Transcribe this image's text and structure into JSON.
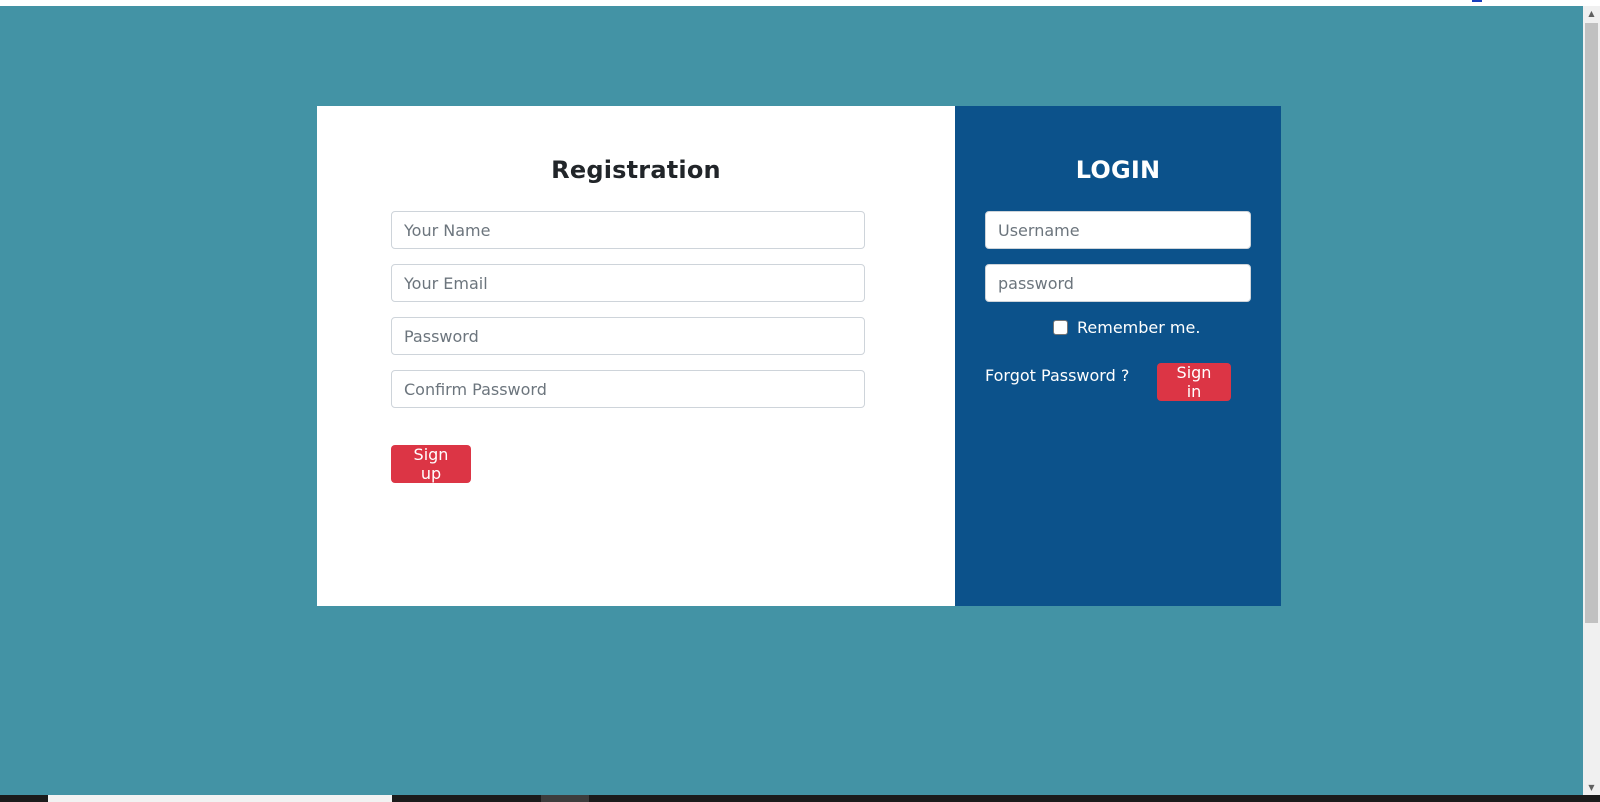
{
  "registration": {
    "title": "Registration",
    "name_placeholder": "Your Name",
    "email_placeholder": "Your Email",
    "password_placeholder": "Password",
    "confirm_placeholder": "Confirm Password",
    "signup_label": "Sign up"
  },
  "login": {
    "title": "LOGIN",
    "username_placeholder": "Username",
    "password_placeholder": "password",
    "remember_label": "Remember me.",
    "forgot_label": "Forgot Password ?",
    "signin_label": "Sign in"
  },
  "colors": {
    "page_background": "#4393a5",
    "login_panel": "#0c528b",
    "button": "#dc3545"
  }
}
